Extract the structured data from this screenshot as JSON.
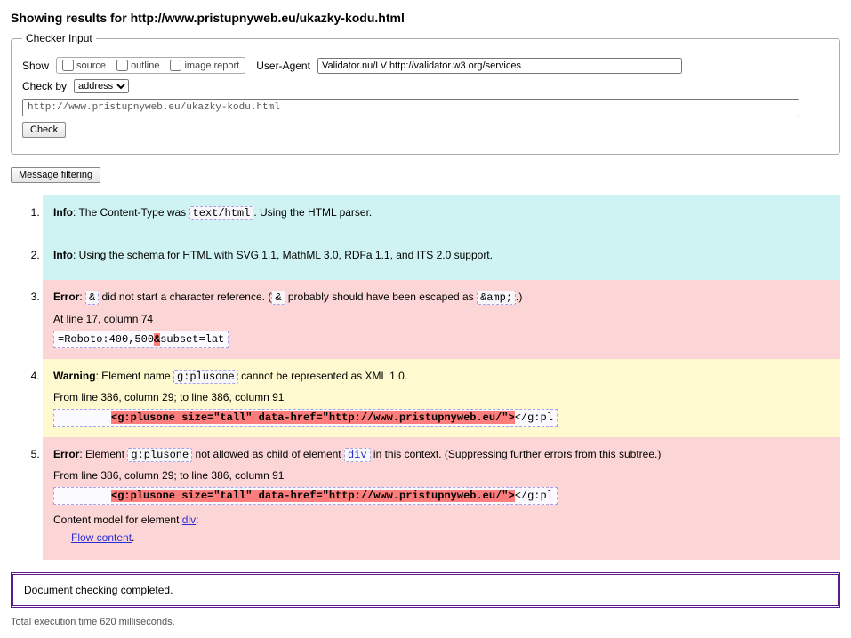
{
  "header": {
    "prefix": "Showing results for ",
    "url": "http://www.pristupnyweb.eu/ukazky-kodu.html"
  },
  "checker": {
    "legend": "Checker Input",
    "show_label": "Show",
    "opt_source": "source",
    "opt_outline": "outline",
    "opt_image_report": "image report",
    "ua_label": "User-Agent",
    "ua_value": "Validator.nu/LV http://validator.w3.org/services",
    "checkby_label": "Check by",
    "checkby_option": "address",
    "address_value": "http://www.pristupnyweb.eu/ukazky-kodu.html",
    "check_btn": "Check"
  },
  "filter_btn": "Message filtering",
  "msgs": {
    "m1": {
      "label": "Info",
      "t1": ": The Content-Type was ",
      "code": "text/html",
      "t2": ". Using the HTML parser."
    },
    "m2": {
      "label": "Info",
      "t1": ": Using the schema for HTML with SVG 1.1, MathML 3.0, RDFa 1.1, and ITS 2.0 support."
    },
    "m3": {
      "label": "Error",
      "t1": ": ",
      "c1": "&",
      "t2": " did not start a character reference. (",
      "c2": "&",
      "t3": " probably should have been escaped as ",
      "c3": "&amp;",
      "t4": ".)",
      "loc": "At line 17, column 74",
      "code_pre": "=Roboto:400,500",
      "code_hl": "&",
      "code_post": "subset=lat"
    },
    "m4": {
      "label": "Warning",
      "t1": ": Element name ",
      "c1": "g:plusone",
      "t2": " cannot be represented as XML 1.0.",
      "loc": "From line 386, column 29; to line 386, column 91",
      "code_hl": "<g:plusone size=\"tall\" data-href=\"http://www.pristupnyweb.eu/\">",
      "code_post": "</g:pl"
    },
    "m5": {
      "label": "Error",
      "t1": ": Element ",
      "c1": "g:plusone",
      "t2": " not allowed as child of element ",
      "link1": "div",
      "t3": " in this context. (Suppressing further errors from this subtree.)",
      "loc": "From line 386, column 29; to line 386, column 91",
      "code_hl": "<g:plusone size=\"tall\" data-href=\"http://www.pristupnyweb.eu/\">",
      "code_post": "</g:pl",
      "cm_label": "Content model for element ",
      "cm_link": "div",
      "cm_tail": ":",
      "flow_link": "Flow content",
      "flow_tail": "."
    }
  },
  "completion": "Document checking completed.",
  "timing": "Total execution time 620 milliseconds."
}
